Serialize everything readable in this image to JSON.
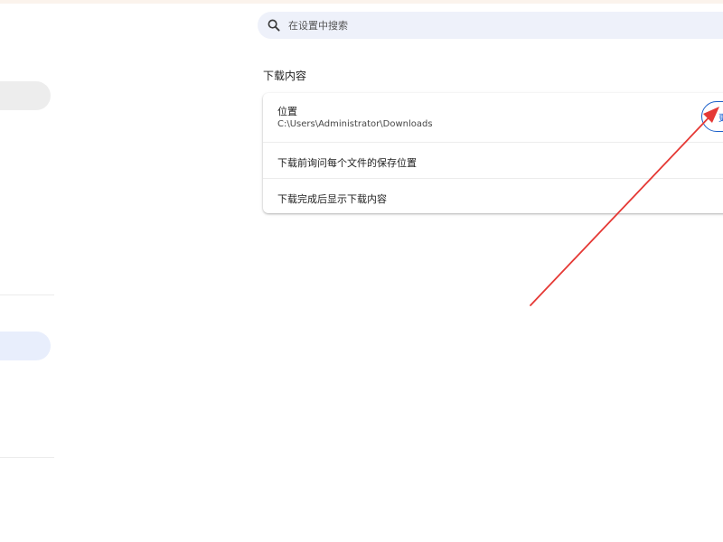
{
  "search": {
    "placeholder": "在设置中搜索"
  },
  "downloads": {
    "section_title": "下载内容",
    "location_label": "位置",
    "location_path": "C:\\Users\\Administrator\\Downloads",
    "change_button_label": "更",
    "ask_label": "下载前询问每个文件的保存位置",
    "show_label": "下载完成后显示下载内容"
  },
  "colors": {
    "accent": "#0b57d0",
    "annotation_arrow": "#e53935",
    "search_bg": "#eef1fa",
    "sidebar_active": "#e8eefc"
  },
  "icons": {
    "search": "search-icon"
  }
}
